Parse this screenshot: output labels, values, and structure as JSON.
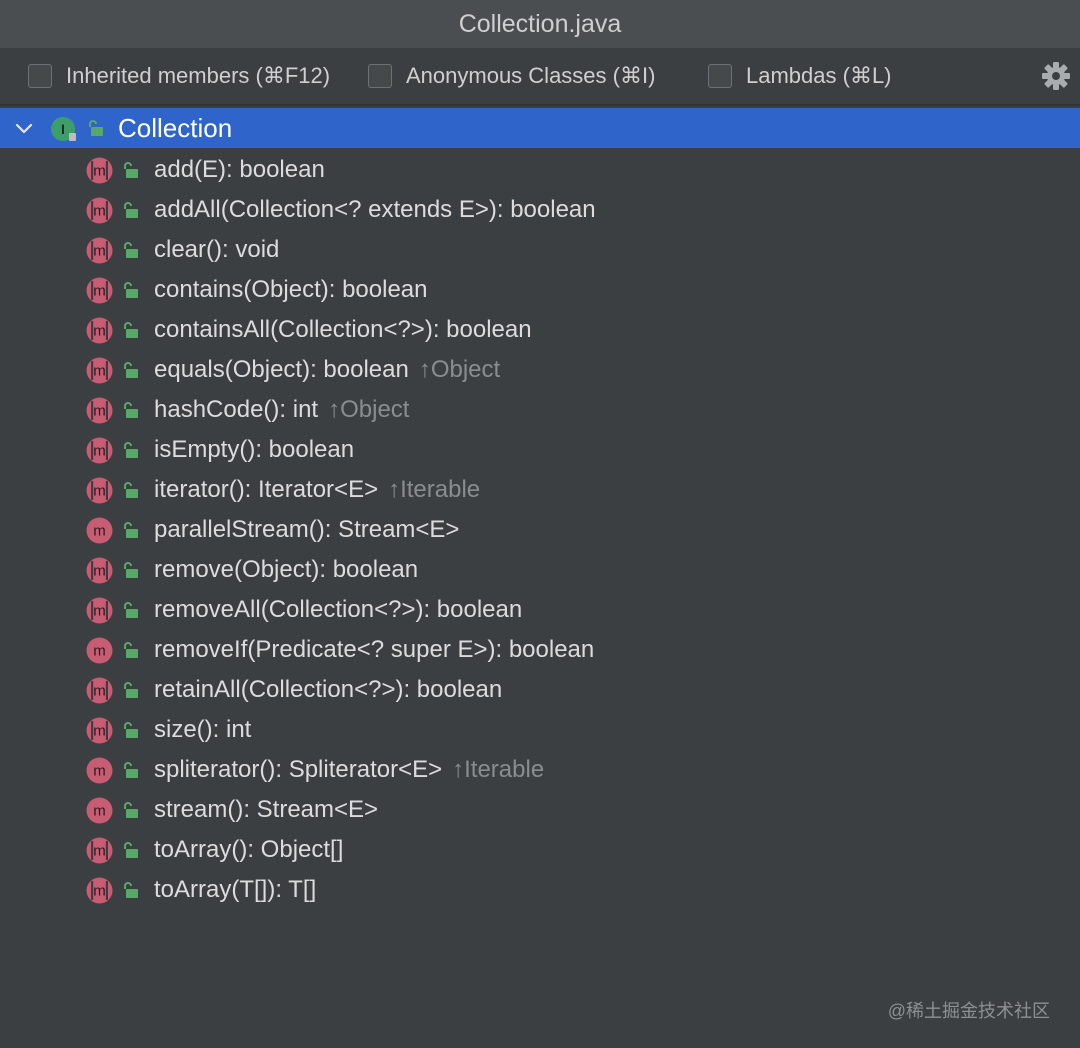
{
  "window": {
    "title": "Collection.java"
  },
  "toolbar": {
    "inherited_label": "Inherited members (⌘F12)",
    "anonymous_label": "Anonymous Classes (⌘I)",
    "lambdas_label": "Lambdas (⌘L)"
  },
  "tree": {
    "root_label": "Collection",
    "members": [
      {
        "sig": "add(E): boolean",
        "inherited": "",
        "abstract": true
      },
      {
        "sig": "addAll(Collection<? extends E>): boolean",
        "inherited": "",
        "abstract": true
      },
      {
        "sig": "clear(): void",
        "inherited": "",
        "abstract": true
      },
      {
        "sig": "contains(Object): boolean",
        "inherited": "",
        "abstract": true
      },
      {
        "sig": "containsAll(Collection<?>): boolean",
        "inherited": "",
        "abstract": true
      },
      {
        "sig": "equals(Object): boolean",
        "inherited": "↑Object",
        "abstract": true
      },
      {
        "sig": "hashCode(): int",
        "inherited": "↑Object",
        "abstract": true
      },
      {
        "sig": "isEmpty(): boolean",
        "inherited": "",
        "abstract": true
      },
      {
        "sig": "iterator(): Iterator<E>",
        "inherited": "↑Iterable",
        "abstract": true
      },
      {
        "sig": "parallelStream(): Stream<E>",
        "inherited": "",
        "abstract": false
      },
      {
        "sig": "remove(Object): boolean",
        "inherited": "",
        "abstract": true
      },
      {
        "sig": "removeAll(Collection<?>): boolean",
        "inherited": "",
        "abstract": true
      },
      {
        "sig": "removeIf(Predicate<? super E>): boolean",
        "inherited": "",
        "abstract": false
      },
      {
        "sig": "retainAll(Collection<?>): boolean",
        "inherited": "",
        "abstract": true
      },
      {
        "sig": "size(): int",
        "inherited": "",
        "abstract": true
      },
      {
        "sig": "spliterator(): Spliterator<E>",
        "inherited": "↑Iterable",
        "abstract": false
      },
      {
        "sig": "stream(): Stream<E>",
        "inherited": "",
        "abstract": false
      },
      {
        "sig": "toArray(): Object[]",
        "inherited": "",
        "abstract": true
      },
      {
        "sig": "toArray(T[]): T[]",
        "inherited": "",
        "abstract": true
      }
    ]
  },
  "watermark": "@稀土掘金技术社区",
  "colors": {
    "selection": "#2f65ca",
    "method_icon": "#c75c73",
    "interface_icon": "#3e9e6a",
    "lock": "#59a869"
  },
  "icons": {
    "chevron": "chevron-down-icon",
    "interface": "interface-icon",
    "method": "method-icon",
    "lock": "public-lock-icon",
    "settings": "gear-icon"
  }
}
